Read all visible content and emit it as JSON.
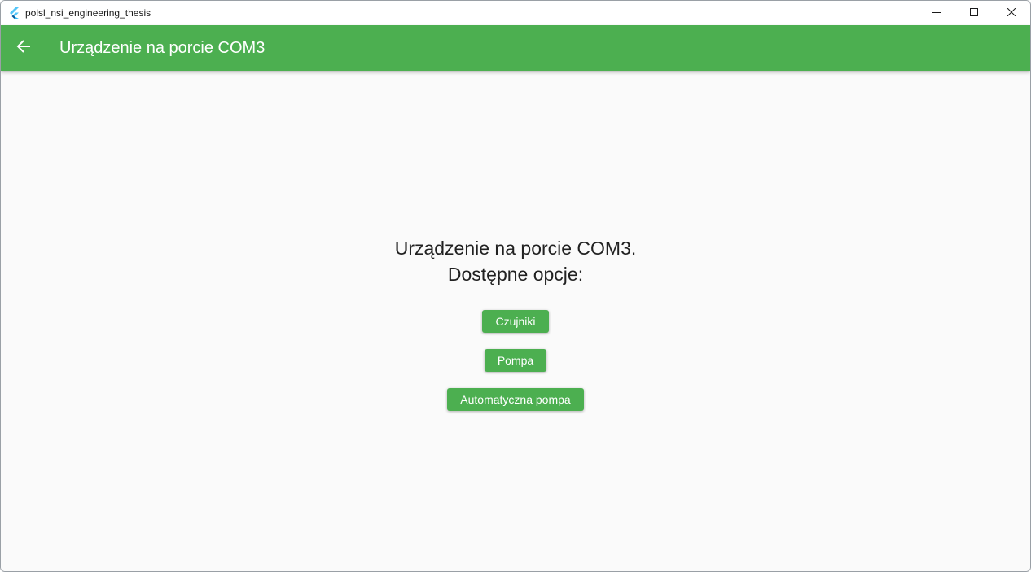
{
  "window": {
    "title": "polsl_nsi_engineering_thesis"
  },
  "appbar": {
    "title": "Urządzenie na porcie COM3"
  },
  "main": {
    "heading_line1": "Urządzenie na porcie COM3.",
    "heading_line2": "Dostępne opcje:",
    "buttons": [
      {
        "label": "Czujniki"
      },
      {
        "label": "Pompa"
      },
      {
        "label": "Automatyczna pompa"
      }
    ]
  },
  "colors": {
    "accent": "#4caf50",
    "background": "#fafafa"
  },
  "icons": {
    "app": "flutter-icon",
    "back": "arrow-back-icon",
    "minimize": "minimize-icon",
    "maximize": "maximize-icon",
    "close": "close-icon"
  }
}
